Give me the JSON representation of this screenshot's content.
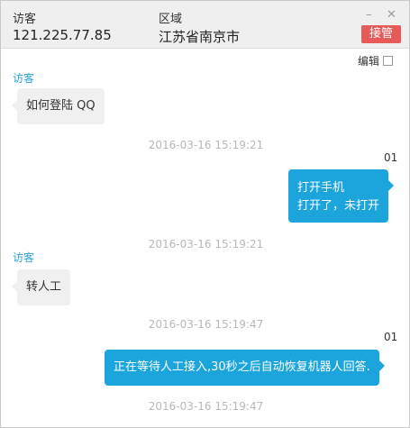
{
  "header": {
    "visitor_label": "访客",
    "visitor_ip": "121.225.77.85",
    "region_label": "区域",
    "region_value": "江苏省南京市",
    "minimize": "–",
    "close": "✕",
    "takeover_label": "接管"
  },
  "toolbar": {
    "edit_label": "编辑"
  },
  "messages": [
    {
      "sender": "访客",
      "text": "如何登陆 QQ",
      "time": "2016-03-16 15:19:21"
    },
    {
      "sender": "01",
      "lines": [
        "打开手机",
        "打开了，未打开"
      ],
      "time": "2016-03-16 15:19:21"
    },
    {
      "sender": "访客",
      "text": "转人工",
      "time": "2016-03-16 15:19:47"
    },
    {
      "sender": "01",
      "text": "正在等待人工接入,30秒之后自动恢复机器人回答.",
      "time": "2016-03-16 15:19:47"
    }
  ],
  "colors": {
    "accent": "#1ba5dc",
    "takeover": "#e75a5a",
    "visitor_name": "#2aa3d4"
  }
}
